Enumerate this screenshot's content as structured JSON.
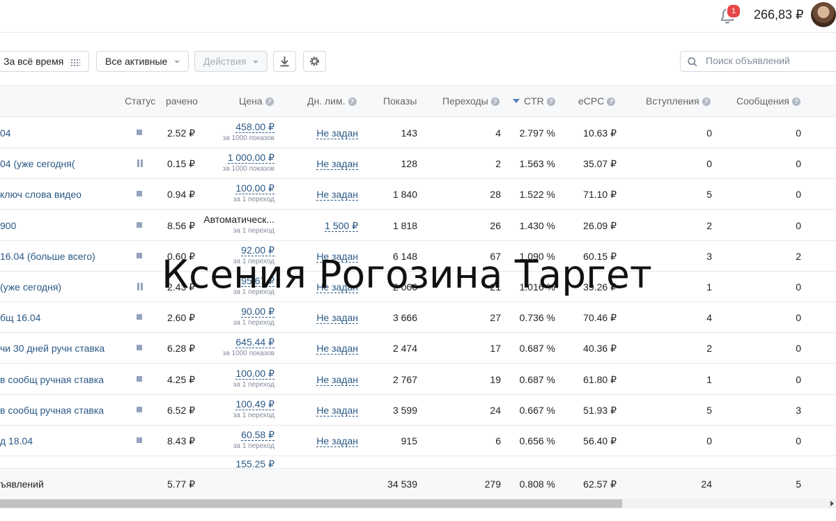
{
  "header": {
    "notification_count": "1",
    "balance": "266,83 ₽"
  },
  "toolbar": {
    "period": "За всё время",
    "filter": "Все активные",
    "actions": "Действия",
    "search_placeholder": "Поиск объявлений"
  },
  "columns": {
    "status": "Статус",
    "spent": "рачено",
    "price": "Цена",
    "day_limit": "Дн. лим.",
    "impressions": "Показы",
    "clicks": "Переходы",
    "ctr": "CTR",
    "ecpc": "eCPC",
    "joins": "Вступления",
    "messages": "Сообщения"
  },
  "rows": [
    {
      "name": "04",
      "status": "stop",
      "spent": "2.52 ₽",
      "price": "458.00 ₽",
      "price_note": "за 1000 показов",
      "limit": "Не задан",
      "impressions": "143",
      "clicks": "4",
      "ctr": "2.797 %",
      "ecpc": "10.63 ₽",
      "joins": "0",
      "messages": "0"
    },
    {
      "name": "04 (уже сегодня(",
      "status": "pause",
      "spent": "0.15 ₽",
      "price": "1 000.00 ₽",
      "price_note": "за 1000 показов",
      "limit": "Не задан",
      "impressions": "128",
      "clicks": "2",
      "ctr": "1.563 %",
      "ecpc": "35.07 ₽",
      "joins": "0",
      "messages": "0"
    },
    {
      "name": "ключ слова видео",
      "status": "stop",
      "spent": "0.94 ₽",
      "price": "100.00 ₽",
      "price_note": "за 1 переход",
      "limit": "Не задан",
      "impressions": "1 840",
      "clicks": "28",
      "ctr": "1.522 %",
      "ecpc": "71.10 ₽",
      "joins": "5",
      "messages": "0"
    },
    {
      "name": "900",
      "status": "stop",
      "spent": "8.56 ₽",
      "price": "Автоматическ...",
      "price_note": "за 1 переход",
      "limit": "1 500 ₽",
      "impressions": "1 818",
      "clicks": "26",
      "ctr": "1.430 %",
      "ecpc": "26.09 ₽",
      "joins": "2",
      "messages": "0"
    },
    {
      "name": "16.04 (больше всего)",
      "status": "stop",
      "spent": "0.60 ₽",
      "price": "92.00 ₽",
      "price_note": "за 1 переход",
      "limit": "Не задан",
      "impressions": "6 148",
      "clicks": "67",
      "ctr": "1.090 %",
      "ecpc": "60.15 ₽",
      "joins": "3",
      "messages": "2"
    },
    {
      "name": "(уже сегодня)",
      "status": "pause",
      "spent": "2.43 ₽",
      "price": "95.67 ₽",
      "price_note": "за 1 переход",
      "limit": "Не задан",
      "impressions": "2 066",
      "clicks": "21",
      "ctr": "1.016 %",
      "ecpc": "39.26 ₽",
      "joins": "1",
      "messages": "0"
    },
    {
      "name": "бщ 16.04",
      "status": "stop",
      "spent": "2.60 ₽",
      "price": "90.00 ₽",
      "price_note": "за 1 переход",
      "limit": "Не задан",
      "impressions": "3 666",
      "clicks": "27",
      "ctr": "0.736 %",
      "ecpc": "70.46 ₽",
      "joins": "4",
      "messages": "0"
    },
    {
      "name": "чи 30 дней ручн ставка",
      "status": "stop",
      "spent": "6.28 ₽",
      "price": "645.44 ₽",
      "price_note": "за 1000 показов",
      "limit": "Не задан",
      "impressions": "2 474",
      "clicks": "17",
      "ctr": "0.687 %",
      "ecpc": "40.36 ₽",
      "joins": "2",
      "messages": "0"
    },
    {
      "name": "в сообщ ручная ставка",
      "status": "stop",
      "spent": "4.25 ₽",
      "price": "100.00 ₽",
      "price_note": "за 1 переход",
      "limit": "Не задан",
      "impressions": "2 767",
      "clicks": "19",
      "ctr": "0.687 %",
      "ecpc": "61.80 ₽",
      "joins": "1",
      "messages": "0"
    },
    {
      "name": "в сообщ ручная ставка",
      "status": "stop",
      "spent": "6.52 ₽",
      "price": "100.49 ₽",
      "price_note": "за 1 переход",
      "limit": "Не задан",
      "impressions": "3 599",
      "clicks": "24",
      "ctr": "0.667 %",
      "ecpc": "51.93 ₽",
      "joins": "5",
      "messages": "3"
    },
    {
      "name": "д 18.04",
      "status": "stop",
      "spent": "8.43 ₽",
      "price": "60.58 ₽",
      "price_note": "за 1 переход",
      "limit": "Не задан",
      "impressions": "915",
      "clicks": "6",
      "ctr": "0.656 %",
      "ecpc": "56.40 ₽",
      "joins": "0",
      "messages": "0"
    }
  ],
  "partial_row": {
    "price": "155.25 ₽"
  },
  "total": {
    "label": "ъявлений",
    "spent": "5.77 ₽",
    "impressions": "34 539",
    "clicks": "279",
    "ctr": "0.808 %",
    "ecpc": "62.57 ₽",
    "joins": "24",
    "messages": "5"
  },
  "watermark": "Ксения Рогозина Таргет"
}
